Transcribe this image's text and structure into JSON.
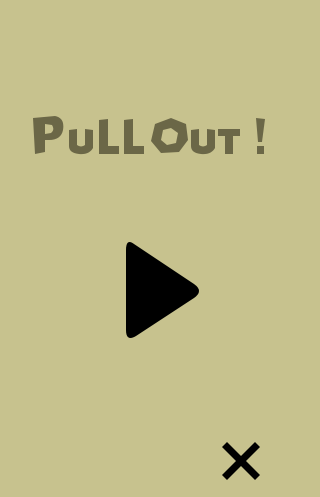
{
  "game": {
    "title": "PULL OUT !",
    "colors": {
      "background": "#c7c28e",
      "title": "#6b6747",
      "icons": "#000000"
    }
  },
  "controls": {
    "play_icon": "play-icon",
    "close_icon": "close-icon"
  }
}
